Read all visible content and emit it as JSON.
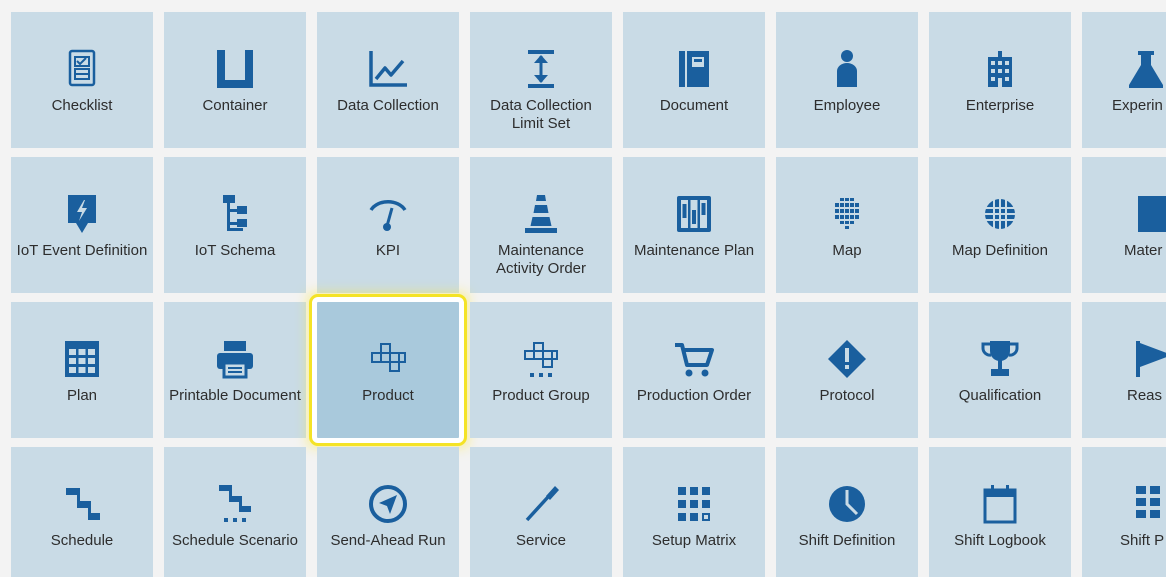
{
  "accent_color": "#1a5f9e",
  "tile_color": "#c9dbe6",
  "selected_tile_color": "#a9c9dc",
  "selection_outline_color": "#f4e326",
  "tiles": [
    {
      "label": "Checklist",
      "icon": "checklist-icon"
    },
    {
      "label": "Container",
      "icon": "container-icon"
    },
    {
      "label": "Data Collection",
      "icon": "data-collection-icon"
    },
    {
      "label": "Data Collection Limit Set",
      "icon": "limit-set-icon"
    },
    {
      "label": "Document",
      "icon": "document-icon"
    },
    {
      "label": "Employee",
      "icon": "employee-icon"
    },
    {
      "label": "Enterprise",
      "icon": "enterprise-icon"
    },
    {
      "label": "Experin Definit",
      "icon": "experiment-flask-icon"
    },
    {
      "label": "IoT Event Definition",
      "icon": "iot-event-icon"
    },
    {
      "label": "IoT Schema",
      "icon": "iot-schema-icon"
    },
    {
      "label": "KPI",
      "icon": "kpi-gauge-icon"
    },
    {
      "label": "Maintenance Activity Order",
      "icon": "traffic-cone-icon"
    },
    {
      "label": "Maintenance Plan",
      "icon": "maintenance-plan-icon"
    },
    {
      "label": "Map",
      "icon": "map-globe-icon"
    },
    {
      "label": "Map Definition",
      "icon": "map-definition-globe-icon"
    },
    {
      "label": "Mater",
      "icon": "material-icon"
    },
    {
      "label": "Plan",
      "icon": "plan-calendar-icon"
    },
    {
      "label": "Printable Document",
      "icon": "printer-icon"
    },
    {
      "label": "Product",
      "icon": "product-icon"
    },
    {
      "label": "Product Group",
      "icon": "product-group-icon"
    },
    {
      "label": "Production Order",
      "icon": "cart-icon"
    },
    {
      "label": "Protocol",
      "icon": "protocol-warning-icon"
    },
    {
      "label": "Qualification",
      "icon": "trophy-icon"
    },
    {
      "label": "Reas",
      "icon": "flag-icon"
    },
    {
      "label": "Schedule",
      "icon": "schedule-icon"
    },
    {
      "label": "Schedule Scenario",
      "icon": "schedule-scenario-icon"
    },
    {
      "label": "Send-Ahead Run",
      "icon": "navigation-arrow-icon"
    },
    {
      "label": "Service",
      "icon": "screwdriver-icon"
    },
    {
      "label": "Setup Matrix",
      "icon": "setup-matrix-icon"
    },
    {
      "label": "Shift Definition",
      "icon": "shift-clock-icon"
    },
    {
      "label": "Shift Logbook",
      "icon": "logbook-calendar-icon"
    },
    {
      "label": "Shift P",
      "icon": "shift-plan-icon"
    }
  ],
  "selected_tile": "Product"
}
